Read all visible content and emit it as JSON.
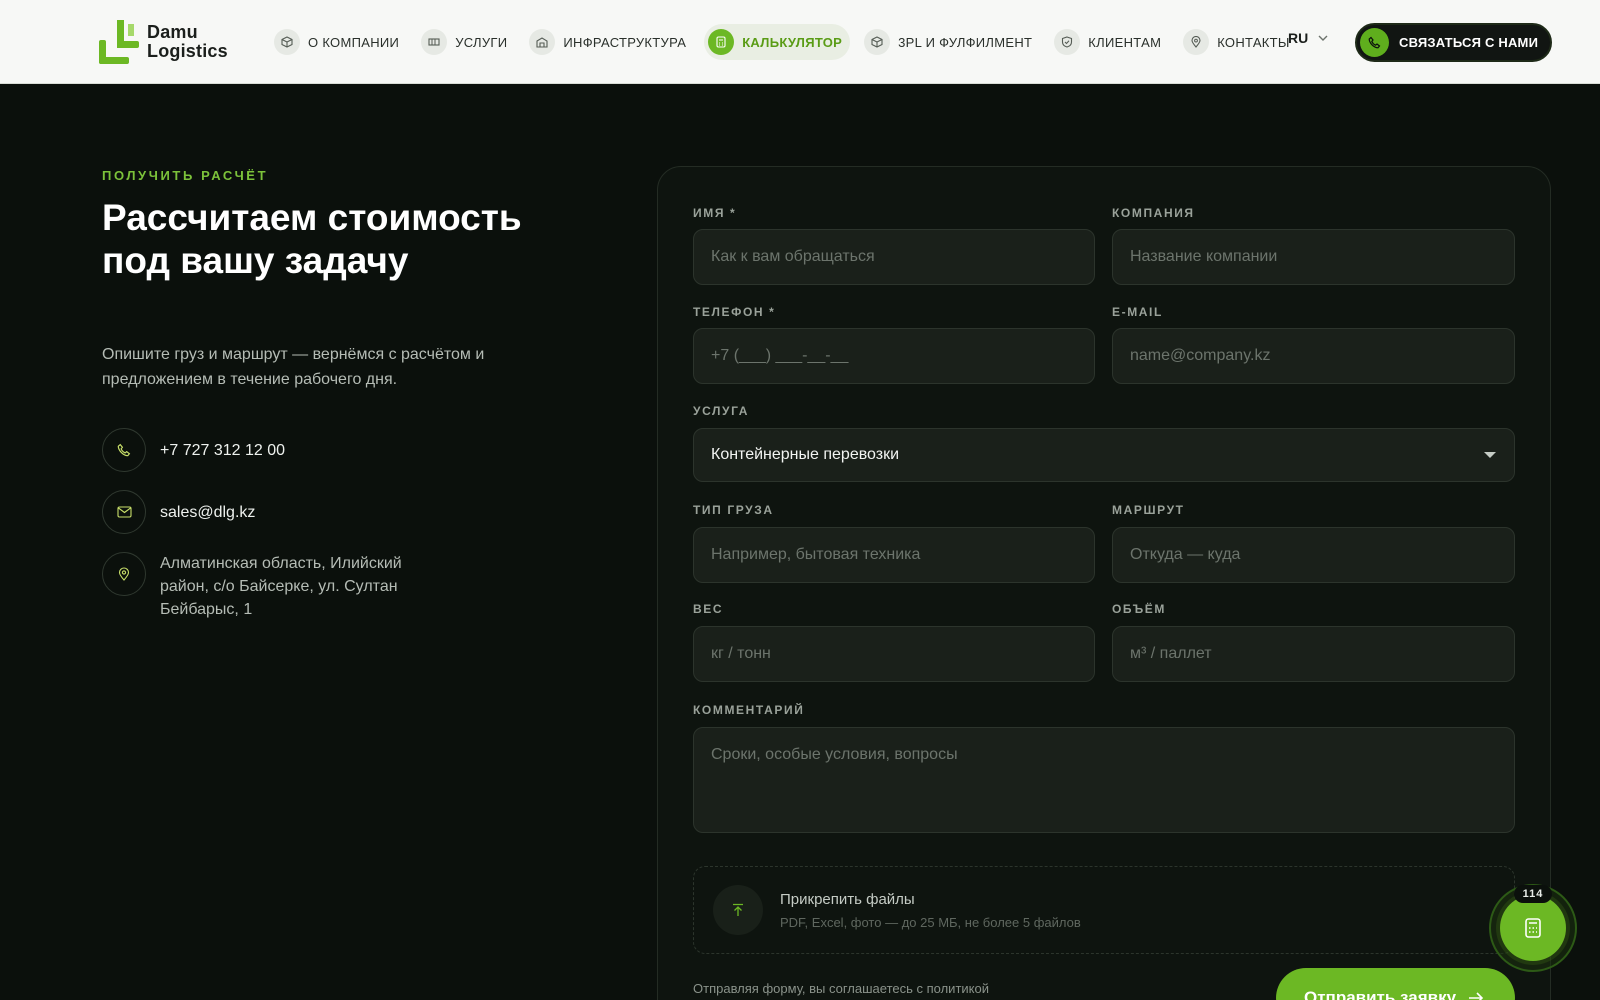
{
  "brand": {
    "name_line1": "Damu",
    "name_line2": "Logistics",
    "accent": "#6cb824"
  },
  "nav": {
    "items": [
      {
        "label": "О компании",
        "icon": "cube-icon"
      },
      {
        "label": "Услуги",
        "icon": "grid-icon"
      },
      {
        "label": "Инфраструктура",
        "icon": "warehouse-icon"
      },
      {
        "label": "Калькулятор",
        "icon": "calculator-icon",
        "active": true
      },
      {
        "label": "3PL и фулфилмент",
        "icon": "box-icon"
      },
      {
        "label": "Клиентам",
        "icon": "shield-icon"
      },
      {
        "label": "Контакты",
        "icon": "pin-icon"
      }
    ],
    "language": "RU",
    "cta_label": "СВЯЗАТЬСЯ С НАМИ"
  },
  "intro": {
    "eyebrow": "ПОЛУЧИТЬ РАСЧЁТ",
    "headline": "Рассчитаем стоимость под вашу задачу",
    "lead": "Опишите груз и маршрут — вернёмся с расчётом и предложением в течение рабочего дня.",
    "phone": "+7 727 312 12 00",
    "email": "sales@dlg.kz",
    "address": "Алматинская область, Илийский район, с/о Байсерке, ул. Султан Бейбарыс, 1"
  },
  "form": {
    "name_label": "ИМЯ *",
    "name_placeholder": "Как к вам обращаться",
    "company_label": "КОМПАНИЯ",
    "company_placeholder": "Название компании",
    "phone_label": "ТЕЛЕФОН *",
    "phone_placeholder": "+7 (___) ___-__-__",
    "email_label": "E-MAIL",
    "email_placeholder": "name@company.kz",
    "service_label": "УСЛУГА",
    "service_value": "Контейнерные перевозки",
    "cargo_label": "ТИП ГРУЗА",
    "cargo_placeholder": "Например, бытовая техника",
    "route_label": "МАРШРУТ",
    "route_placeholder": "Откуда — куда",
    "weight_label": "ВЕС",
    "weight_placeholder": "кг / тонн",
    "volume_label": "ОБЪЁМ",
    "volume_placeholder": "м³ / паллет",
    "comment_label": "КОММЕНТАРИЙ",
    "comment_placeholder": "Сроки, особые условия, вопросы",
    "attach_title": "Прикрепить файлы",
    "attach_hint": "PDF, Excel, фото — до 25 МБ, не более 5 файлов",
    "consent": "Отправляя форму, вы соглашаетесь с политикой",
    "submit_label": "Отправить заявку"
  },
  "fab": {
    "badge": "114"
  }
}
